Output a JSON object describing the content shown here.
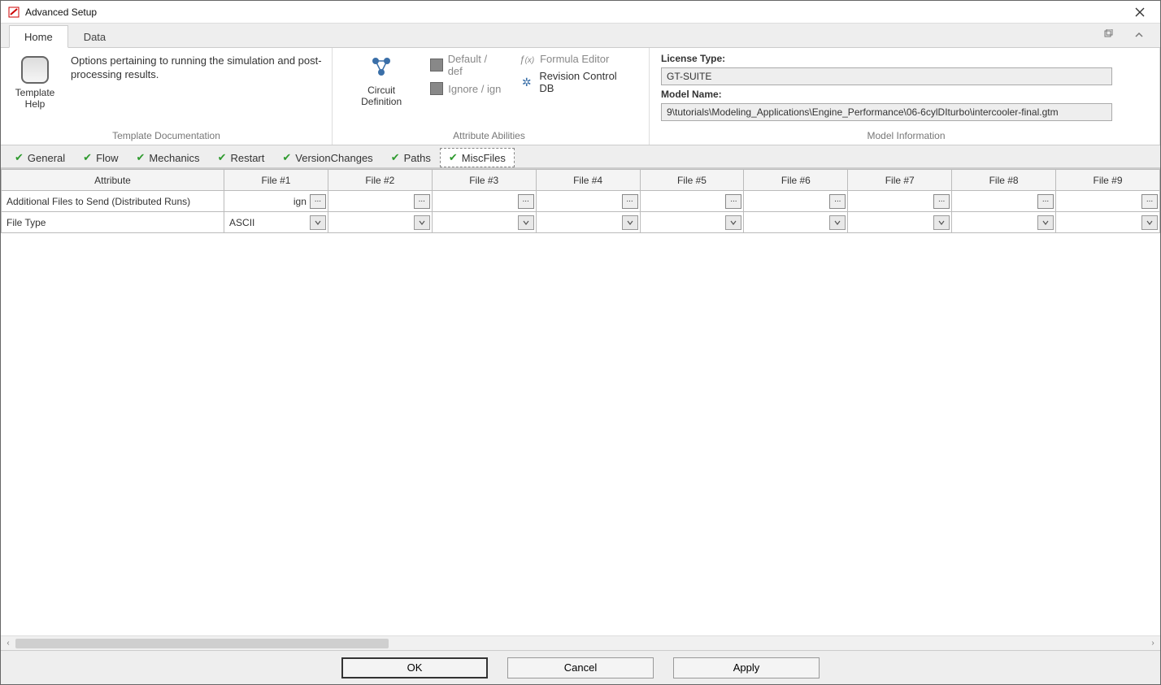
{
  "window": {
    "title": "Advanced Setup"
  },
  "ribbon": {
    "tabs": [
      "Home",
      "Data"
    ],
    "active_tab": 0,
    "group1": {
      "description": "Options pertaining to running the simulation and post-processing results.",
      "template_help": "Template Help",
      "label": "Template Documentation"
    },
    "group2": {
      "circuit": "Circuit Definition",
      "default": "Default / def",
      "ignore": "Ignore / ign",
      "formula": "Formula Editor",
      "revision": "Revision Control DB",
      "label": "Attribute Abilities"
    },
    "group3": {
      "license_label": "License Type:",
      "license_value": "GT-SUITE",
      "model_label": "Model Name:",
      "model_value": "9\\tutorials\\Modeling_Applications\\Engine_Performance\\06-6cylDIturbo\\intercooler-final.gtm",
      "label": "Model Information"
    }
  },
  "subtabs": [
    "General",
    "Flow",
    "Mechanics",
    "Restart",
    "VersionChanges",
    "Paths",
    "MiscFiles"
  ],
  "active_subtab": 6,
  "table": {
    "headers": [
      "Attribute",
      "File #1",
      "File #2",
      "File #3",
      "File #4",
      "File #5",
      "File #6",
      "File #7",
      "File #8",
      "File #9"
    ],
    "rows": [
      {
        "attr": "Additional Files to Send (Distributed Runs)",
        "type": "browse",
        "values": [
          "ign",
          "",
          "",
          "",
          "",
          "",
          "",
          "",
          ""
        ]
      },
      {
        "attr": "File Type",
        "type": "select",
        "values": [
          "ASCII",
          "",
          "",
          "",
          "",
          "",
          "",
          "",
          ""
        ]
      }
    ]
  },
  "footer": {
    "ok": "OK",
    "cancel": "Cancel",
    "apply": "Apply"
  }
}
